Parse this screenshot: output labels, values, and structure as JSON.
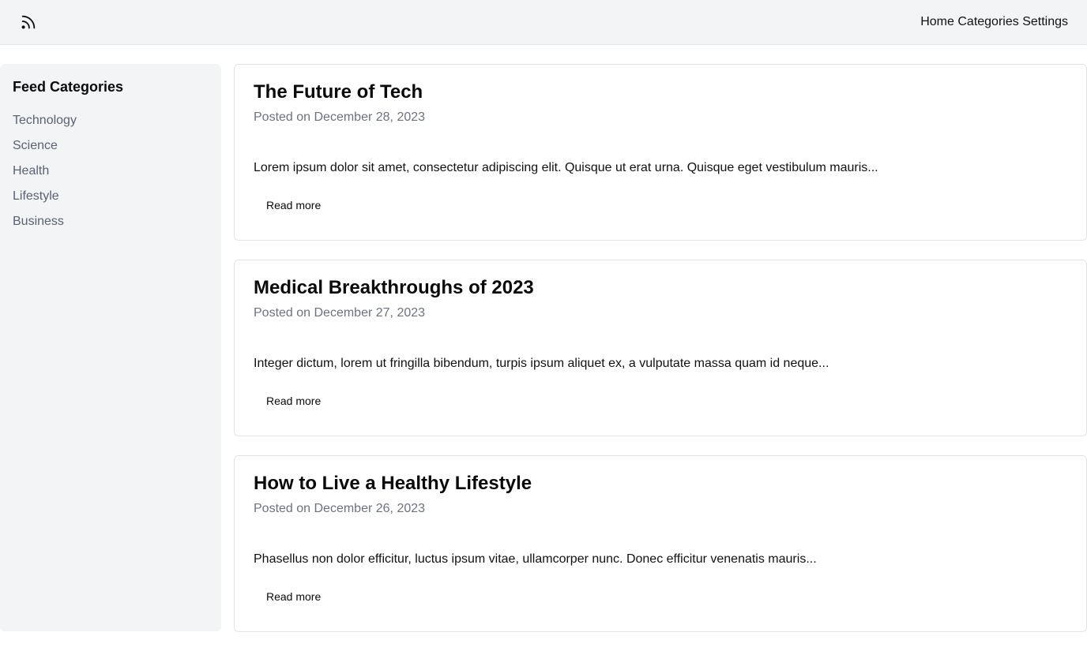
{
  "header": {
    "logo_icon": "rss-icon",
    "nav": [
      "Home",
      "Categories",
      "Settings"
    ]
  },
  "sidebar": {
    "title": "Feed Categories",
    "items": [
      "Technology",
      "Science",
      "Health",
      "Lifestyle",
      "Business"
    ]
  },
  "articles": [
    {
      "title": "The Future of Tech",
      "date": "Posted on December 28, 2023",
      "excerpt": "Lorem ipsum dolor sit amet, consectetur adipiscing elit. Quisque ut erat urna. Quisque eget vestibulum mauris...",
      "read_more": "Read more"
    },
    {
      "title": "Medical Breakthroughs of 2023",
      "date": "Posted on December 27, 2023",
      "excerpt": "Integer dictum, lorem ut fringilla bibendum, turpis ipsum aliquet ex, a vulputate massa quam id neque...",
      "read_more": "Read more"
    },
    {
      "title": "How to Live a Healthy Lifestyle",
      "date": "Posted on December 26, 2023",
      "excerpt": "Phasellus non dolor efficitur, luctus ipsum vitae, ullamcorper nunc. Donec efficitur venenatis mauris...",
      "read_more": "Read more"
    }
  ],
  "colors": {
    "header_bg": "#f2f4f5",
    "sidebar_bg": "#f2f4f5",
    "muted_text": "#6b7280",
    "card_border": "#e1e4e8"
  }
}
